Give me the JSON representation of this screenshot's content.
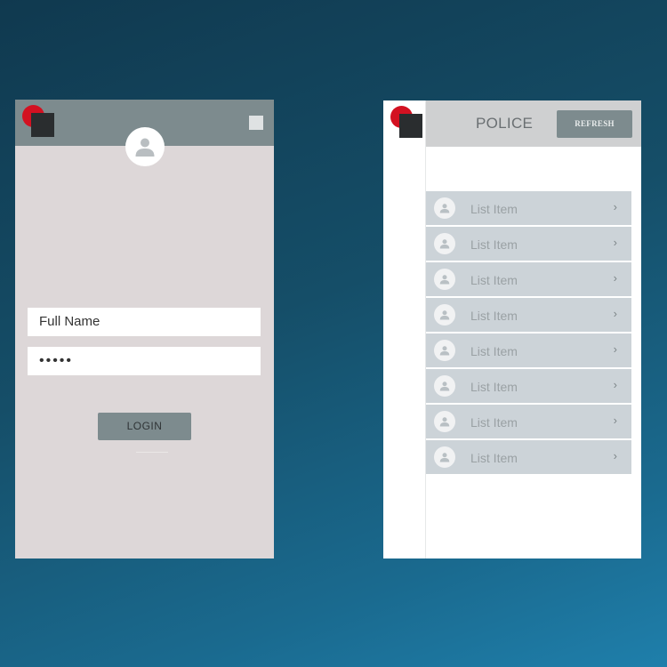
{
  "login_screen": {
    "header_icon": "profile-avatar-icon",
    "name_field": {
      "value": "Full Name"
    },
    "password_field": {
      "value": "•••••"
    },
    "login_button_label": "LOGIN"
  },
  "list_screen": {
    "title": "POLICE",
    "refresh_button_label": "REFRESH",
    "items": [
      {
        "label": "List Item",
        "icon": "person-icon",
        "chevron": "›"
      },
      {
        "label": "List Item",
        "icon": "person-icon",
        "chevron": "›"
      },
      {
        "label": "List Item",
        "icon": "person-icon",
        "chevron": "›"
      },
      {
        "label": "List Item",
        "icon": "person-icon",
        "chevron": "›"
      },
      {
        "label": "List Item",
        "icon": "person-icon",
        "chevron": "›"
      },
      {
        "label": "List Item",
        "icon": "person-icon",
        "chevron": "›"
      },
      {
        "label": "List Item",
        "icon": "person-icon",
        "chevron": "›"
      },
      {
        "label": "List Item",
        "icon": "person-icon",
        "chevron": "›"
      }
    ]
  },
  "colors": {
    "background_dark": "#10394f",
    "background_light": "#1f7fab",
    "header_gray": "#7d8b8e",
    "login_panel": "#ddd7d8",
    "list_item": "#ccd3d8",
    "logo_red": "#d31121",
    "logo_black": "#2a2d2f"
  }
}
